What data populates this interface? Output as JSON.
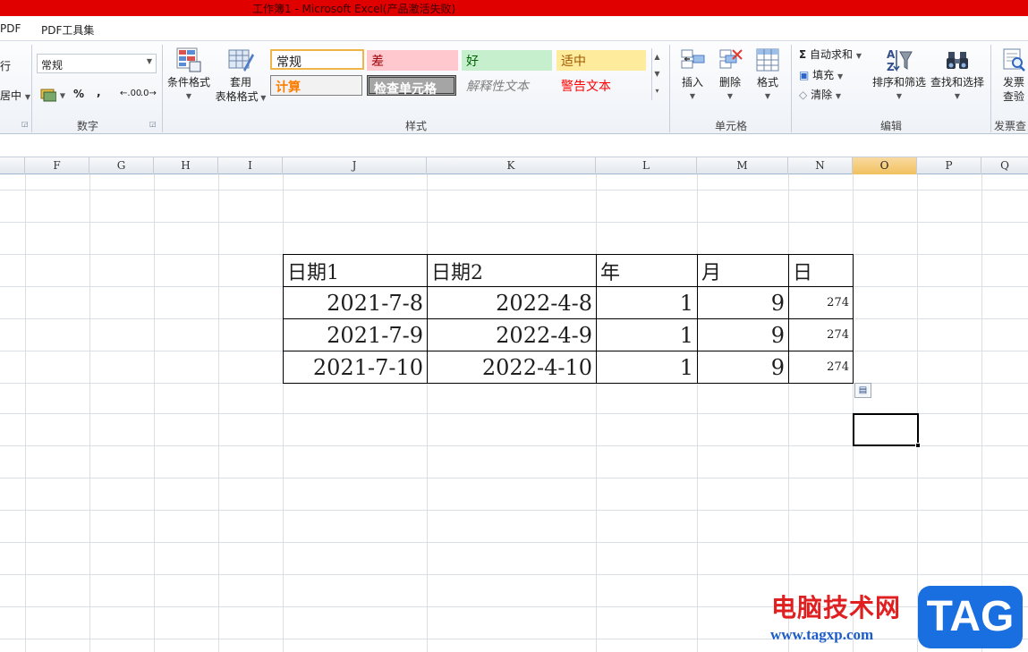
{
  "window": {
    "title": "工作簿1  -  Microsoft Excel(产品激活失败)"
  },
  "tabs": [
    "PDF",
    "PDF工具集"
  ],
  "ribbon": {
    "alignment": {
      "wrap_label": "行",
      "merge_label": "居中"
    },
    "number": {
      "format_value": "常规",
      "percent": "%",
      "comma": ",",
      "inc_decimal": ".00",
      "dec_decimal": ".0",
      "group_label": "数字"
    },
    "styles": {
      "cond_format": "条件格式",
      "table_format_1": "套用",
      "table_format_2": "表格格式",
      "cells": {
        "normal": "常规",
        "bad": "差",
        "good": "好",
        "neutral": "适中",
        "calculation": "计算",
        "check_cell": "检查单元格",
        "explanatory": "解释性文本",
        "warning": "警告文本"
      },
      "group_label": "样式"
    },
    "cells": {
      "insert": "插入",
      "delete": "删除",
      "format": "格式",
      "group_label": "单元格"
    },
    "editing": {
      "autosum": "自动求和",
      "fill": "填充",
      "clear": "清除",
      "sort_filter": "排序和筛选",
      "find_select": "查找和选择",
      "group_label": "编辑"
    },
    "invoice": {
      "label_1": "发票",
      "label_2": "查验",
      "group_label": "发票查"
    }
  },
  "columns": [
    "F",
    "G",
    "H",
    "I",
    "J",
    "K",
    "L",
    "M",
    "N",
    "O",
    "P",
    "Q"
  ],
  "table": {
    "headers": [
      "日期1",
      "日期2",
      "年",
      "月",
      "日"
    ],
    "rows": [
      [
        "2021-7-8",
        "2022-4-8",
        "1",
        "9",
        "274"
      ],
      [
        "2021-7-9",
        "2022-4-9",
        "1",
        "9",
        "274"
      ],
      [
        "2021-7-10",
        "2022-4-10",
        "1",
        "9",
        "274"
      ]
    ]
  },
  "watermark": {
    "site_name": "电脑技术网",
    "url": "www.tagxp.com",
    "tag": "TAG"
  }
}
